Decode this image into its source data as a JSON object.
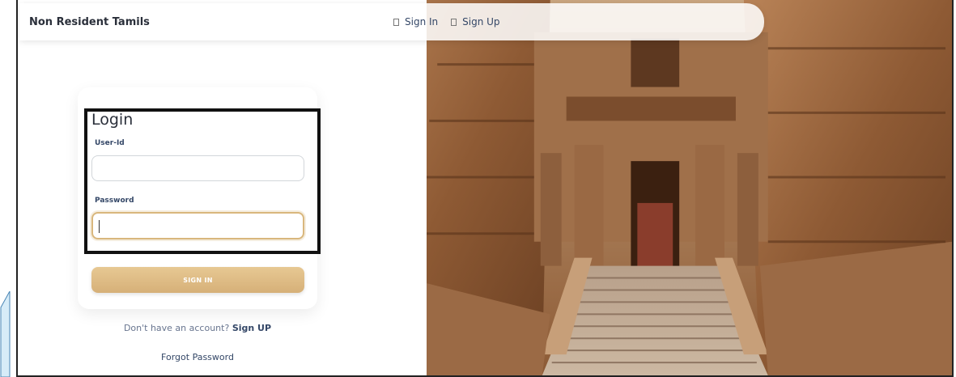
{
  "navbar": {
    "brand": "Non Resident Tamils",
    "sign_in": "Sign In",
    "sign_up": "Sign Up"
  },
  "login": {
    "title": "Login",
    "userid_label": "User-Id",
    "userid_value": "",
    "password_label": "Password",
    "password_value": "",
    "signin_button": "SIGN IN"
  },
  "footer": {
    "no_account": "Don't have an account?",
    "signup_link": "Sign UP",
    "forgot": "Forgot Password"
  },
  "colors": {
    "accent": "#d9b77d",
    "text": "#344767"
  },
  "icons": {
    "sign_in_icon": "checkbox-square",
    "sign_up_icon": "checkbox-square"
  },
  "background": {
    "scene": "temple-entrance-stairs"
  }
}
